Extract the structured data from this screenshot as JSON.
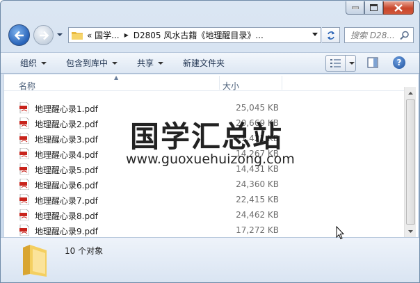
{
  "window": {
    "address": {
      "segments": [
        "«  国学...",
        "D2805 风水古籍《地理醒目录》..."
      ]
    },
    "search_placeholder": "搜索 D28..."
  },
  "toolbar": {
    "organize": "组织",
    "include_library": "包含到库中",
    "share": "共享",
    "new_folder": "新建文件夹"
  },
  "columns": {
    "name": "名称",
    "size": "大小"
  },
  "files": [
    {
      "name": "地理醒心录1.pdf",
      "size": "25,045 KB"
    },
    {
      "name": "地理醒心录2.pdf",
      "size": "20,669 KB"
    },
    {
      "name": "地理醒心录3.pdf",
      "size": "21,421 KB"
    },
    {
      "name": "地理醒心录4.pdf",
      "size": "14,267 KB"
    },
    {
      "name": "地理醒心录5.pdf",
      "size": "14,431 KB"
    },
    {
      "name": "地理醒心录6.pdf",
      "size": "24,360 KB"
    },
    {
      "name": "地理醒心录7.pdf",
      "size": "22,415 KB"
    },
    {
      "name": "地理醒心录8.pdf",
      "size": "24,462 KB"
    },
    {
      "name": "地理醒心录9.pdf",
      "size": "17,272 KB"
    }
  ],
  "watermark": {
    "title": "国学汇总站",
    "url": "www.guoxuehuizong.com"
  },
  "status": {
    "count": "10 个对象"
  },
  "colors": {
    "pdf_red": "#c8231b",
    "folder_yellow": "#f2c94c"
  }
}
